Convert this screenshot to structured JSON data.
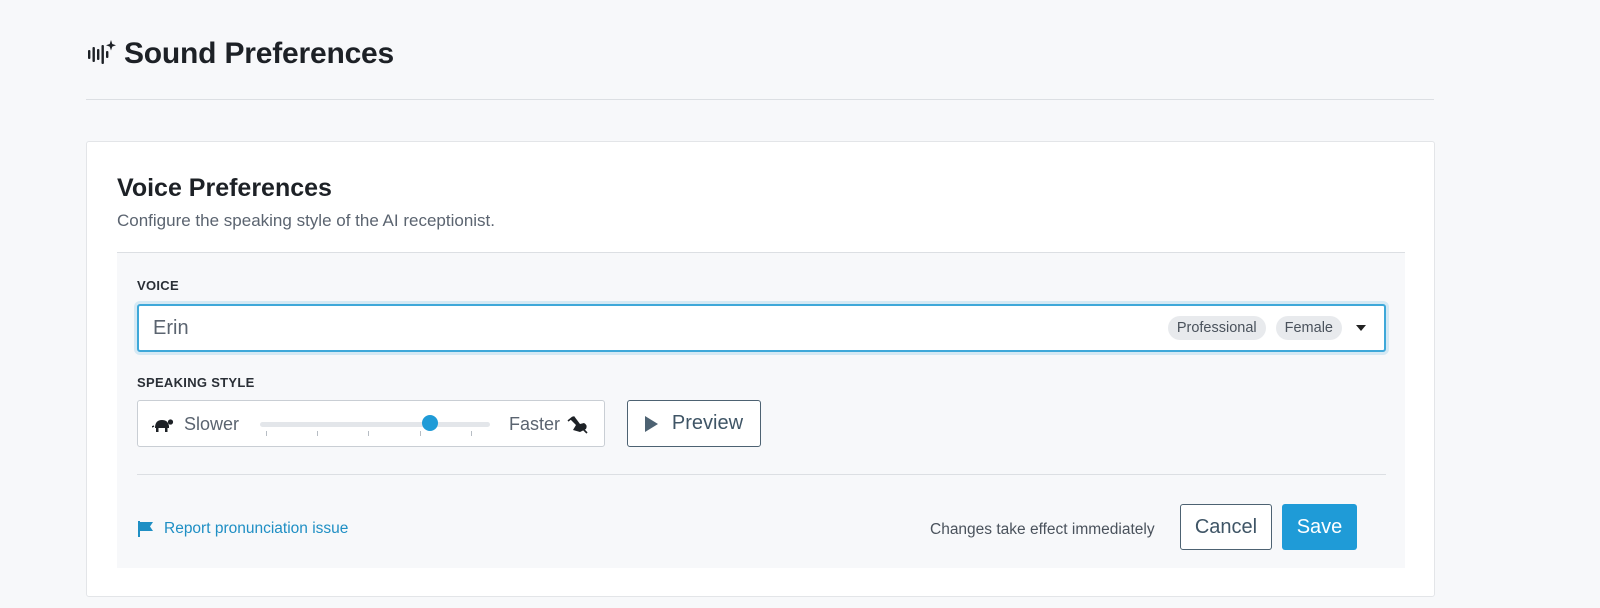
{
  "header": {
    "title": "Sound Preferences",
    "icon": "audio-sparkle-icon"
  },
  "card": {
    "title": "Voice Preferences",
    "description": "Configure the speaking style of the AI receptionist."
  },
  "voice": {
    "label": "VOICE",
    "selected": "Erin",
    "tags": [
      "Professional",
      "Female"
    ]
  },
  "speaking_style": {
    "label": "SPEAKING STYLE",
    "slower_label": "Slower",
    "faster_label": "Faster",
    "step_count": 5,
    "value_step": 4,
    "preview_label": "Preview"
  },
  "footer": {
    "report_link": "Report pronunciation issue",
    "hint": "Changes take effect immediately",
    "cancel_label": "Cancel",
    "save_label": "Save"
  },
  "colors": {
    "accent": "#1f9bd7",
    "secondary": "#4d6272"
  }
}
